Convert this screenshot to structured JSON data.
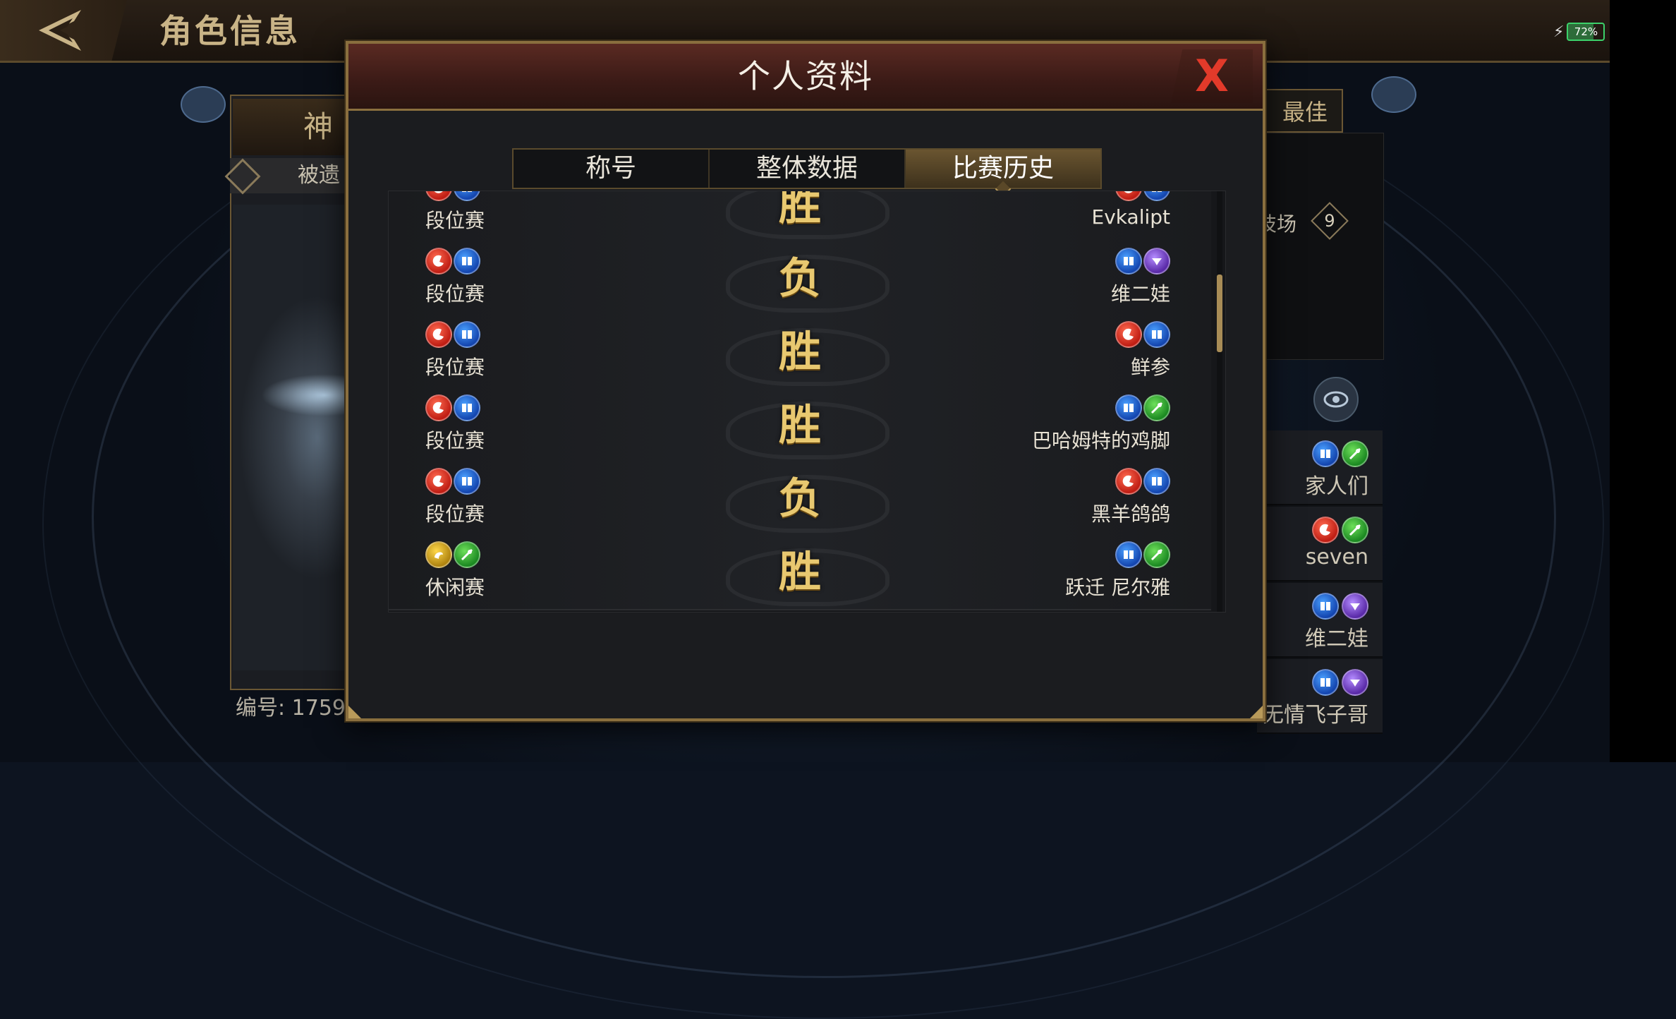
{
  "header": {
    "title": "角色信息"
  },
  "status": {
    "battery": "72%"
  },
  "character": {
    "name": "神",
    "subtitle": "被遗",
    "id_label": "编号: 1759"
  },
  "right_panel": {
    "best_tab": "最佳",
    "arena_label": "技场",
    "arena_value": "9",
    "friends": [
      {
        "name": "家人们",
        "classes": [
          "blue",
          "green"
        ]
      },
      {
        "name": "seven",
        "classes": [
          "red",
          "green"
        ]
      },
      {
        "name": "维二娃",
        "classes": [
          "blue",
          "purple"
        ]
      },
      {
        "name": "无情飞子哥",
        "classes": [
          "blue",
          "purple"
        ]
      }
    ]
  },
  "modal": {
    "title": "个人资料",
    "close_label": "X",
    "tabs": [
      {
        "label": "称号",
        "active": false
      },
      {
        "label": "整体数据",
        "active": false
      },
      {
        "label": "比赛历史",
        "active": true
      }
    ],
    "history": [
      {
        "mode": "段位赛",
        "result": "胜",
        "opponent": "Evkalipt",
        "my_classes": [
          "red",
          "blue"
        ],
        "opp_classes": [
          "red",
          "blue"
        ]
      },
      {
        "mode": "段位赛",
        "result": "负",
        "opponent": "维二娃",
        "my_classes": [
          "red",
          "blue"
        ],
        "opp_classes": [
          "blue",
          "purple"
        ]
      },
      {
        "mode": "段位赛",
        "result": "胜",
        "opponent": "鲜参",
        "my_classes": [
          "red",
          "blue"
        ],
        "opp_classes": [
          "red",
          "blue"
        ]
      },
      {
        "mode": "段位赛",
        "result": "胜",
        "opponent": "巴哈姆特的鸡脚",
        "my_classes": [
          "red",
          "blue"
        ],
        "opp_classes": [
          "blue",
          "green"
        ]
      },
      {
        "mode": "段位赛",
        "result": "负",
        "opponent": "黑羊鸽鸽",
        "my_classes": [
          "red",
          "blue"
        ],
        "opp_classes": [
          "red",
          "blue"
        ]
      },
      {
        "mode": "休闲赛",
        "result": "胜",
        "opponent": "跃迁 尼尔雅",
        "my_classes": [
          "gold",
          "green"
        ],
        "opp_classes": [
          "blue",
          "green"
        ]
      }
    ]
  },
  "colors": {
    "accent_gold": "#b89a5a",
    "result_gold": "#e8c870",
    "close_red": "#e23a2a"
  }
}
